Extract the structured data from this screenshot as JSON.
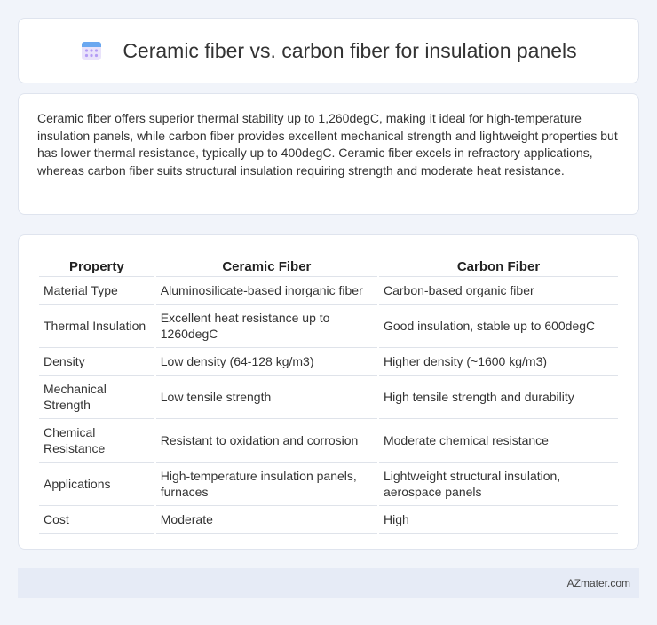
{
  "header": {
    "title": "Ceramic fiber vs. carbon fiber for insulation panels",
    "icon": "calendar-icon"
  },
  "summary": {
    "text": "Ceramic fiber offers superior thermal stability up to 1,260degC, making it ideal for high-temperature insulation panels, while carbon fiber provides excellent mechanical strength and lightweight properties but has lower thermal resistance, typically up to 400degC. Ceramic fiber excels in refractory applications, whereas carbon fiber suits structural insulation requiring strength and moderate heat resistance."
  },
  "table": {
    "headers": [
      "Property",
      "Ceramic Fiber",
      "Carbon Fiber"
    ],
    "rows": [
      [
        "Material Type",
        "Aluminosilicate-based inorganic fiber",
        "Carbon-based organic fiber"
      ],
      [
        "Thermal Insulation",
        "Excellent heat resistance up to 1260degC",
        "Good insulation, stable up to 600degC"
      ],
      [
        "Density",
        "Low density (64-128 kg/m3)",
        "Higher density (~1600 kg/m3)"
      ],
      [
        "Mechanical Strength",
        "Low tensile strength",
        "High tensile strength and durability"
      ],
      [
        "Chemical Resistance",
        "Resistant to oxidation and corrosion",
        "Moderate chemical resistance"
      ],
      [
        "Applications",
        "High-temperature insulation panels, furnaces",
        "Lightweight structural insulation, aerospace panels"
      ],
      [
        "Cost",
        "Moderate",
        "High"
      ]
    ]
  },
  "footer": {
    "brand": "AZmater.com"
  },
  "colors": {
    "background": "#f1f4fa",
    "card": "#ffffff",
    "footer": "#e6ebf6",
    "icon_accent": "#8f7cf0"
  }
}
